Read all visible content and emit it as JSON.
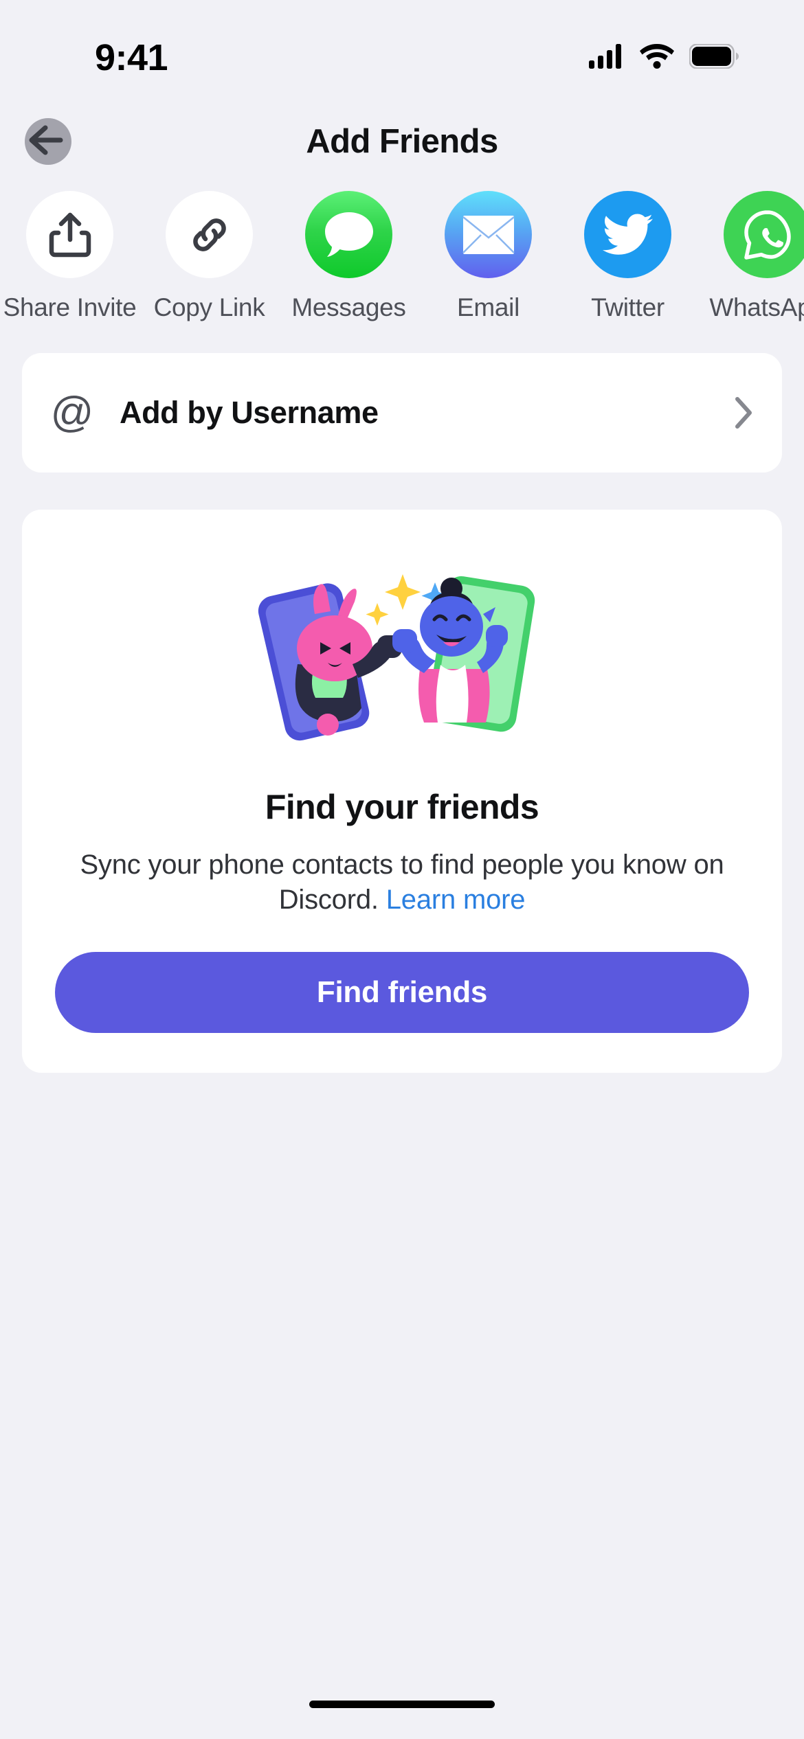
{
  "status_bar": {
    "time": "9:41",
    "icons": [
      "cellular-signal-icon",
      "wifi-icon",
      "battery-icon"
    ]
  },
  "header": {
    "title": "Add Friends",
    "back_icon": "back-arrow-icon"
  },
  "share_row": {
    "items": [
      {
        "label": "Share Invite",
        "icon": "share-upload-icon",
        "style": "plain"
      },
      {
        "label": "Copy Link",
        "icon": "link-chain-icon",
        "style": "plain"
      },
      {
        "label": "Messages",
        "icon": "messages-bubble-icon",
        "style": "messages"
      },
      {
        "label": "Email",
        "icon": "envelope-icon",
        "style": "email"
      },
      {
        "label": "Twitter",
        "icon": "twitter-bird-icon",
        "style": "twitter"
      },
      {
        "label": "WhatsApp",
        "icon": "whatsapp-icon",
        "style": "whatsapp"
      }
    ]
  },
  "username_row": {
    "icon": "at-sign-icon",
    "label": "Add by Username",
    "chevron": "chevron-right-icon"
  },
  "find_friends_card": {
    "illustration": "two-characters-fist-bump-phones-illustration",
    "title": "Find your friends",
    "description": "Sync your phone contacts to find people you know on Discord.",
    "learn_more": "Learn more",
    "button_label": "Find friends"
  },
  "colors": {
    "background": "#F1F1F6",
    "card": "#FFFFFF",
    "blurple": "#5B59DE",
    "link_blue": "#2A7FE0",
    "text_primary": "#111214",
    "text_secondary": "#4E5058",
    "twitter_blue": "#1D9BF0",
    "messages_green": "#2FD44A",
    "whatsapp_green": "#3ED354"
  }
}
